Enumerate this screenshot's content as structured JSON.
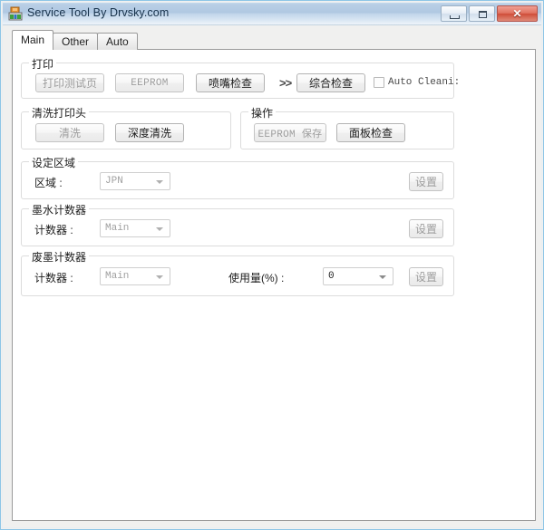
{
  "window": {
    "title": "Service Tool By Drvsky.com",
    "icon": "app-printer-icon",
    "buttons": {
      "minimize": "minimize-icon",
      "maximize": "maximize-icon",
      "close": "✕"
    }
  },
  "tabs": [
    {
      "label": "Main",
      "active": true
    },
    {
      "label": "Other",
      "active": false
    },
    {
      "label": "Auto",
      "active": false
    }
  ],
  "groups": {
    "print": {
      "title": "打印",
      "buttons": [
        {
          "label": "打印测试页",
          "enabled": false
        },
        {
          "label": "EEPROM",
          "enabled": false
        },
        {
          "label": "喷嘴检查",
          "enabled": true
        },
        {
          "label": "综合检查",
          "enabled": true
        }
      ],
      "separator": ">>",
      "checkbox": {
        "label": "Auto Cleani:",
        "checked": false
      }
    },
    "cleanhead": {
      "title": "清洗打印头",
      "buttons": [
        {
          "label": "清洗",
          "enabled": false
        },
        {
          "label": "深度清洗",
          "enabled": true
        }
      ]
    },
    "operation": {
      "title": "操作",
      "buttons": [
        {
          "label": "EEPROM 保存",
          "enabled": false
        },
        {
          "label": "面板检查",
          "enabled": true
        }
      ]
    },
    "region": {
      "title": "设定区域",
      "field_label": "区域 :",
      "combo_value": "JPN",
      "combo_enabled": false,
      "set_button": "设置"
    },
    "ink_counter": {
      "title": "墨水计数器",
      "field_label": "计数器 :",
      "combo_value": "Main",
      "combo_enabled": false,
      "set_button": "设置"
    },
    "waste_counter": {
      "title": "废墨计数器",
      "field_label": "计数器 :",
      "combo_value": "Main",
      "combo_enabled": false,
      "usage_label": "使用量(%) :",
      "usage_value": "0",
      "usage_enabled": true,
      "set_button": "设置"
    }
  },
  "colors": {
    "titlebar_accent": "#b0c8e2",
    "close_button": "#cf4d38",
    "frame_border": "#8ec6e6"
  }
}
